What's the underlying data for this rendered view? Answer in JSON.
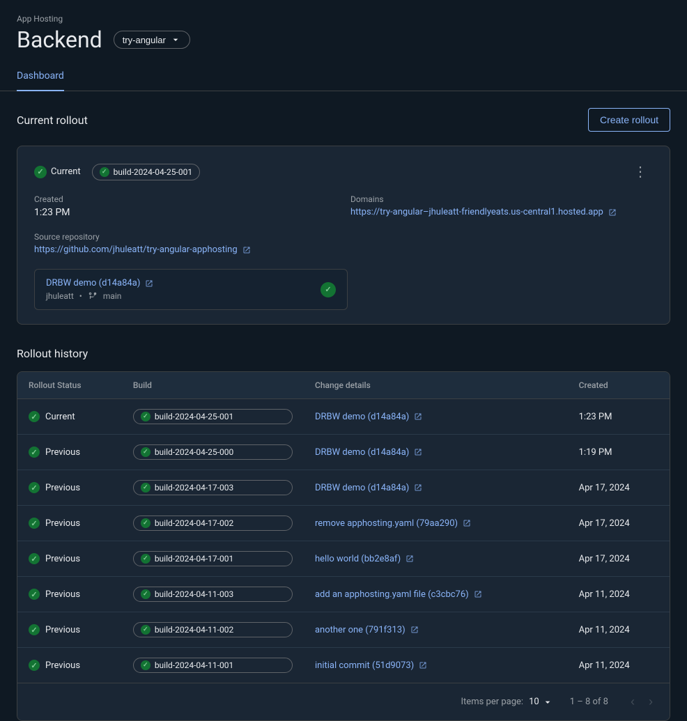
{
  "app": {
    "hosting_label": "App Hosting",
    "backend_title": "Backend",
    "branch": "try-angular"
  },
  "tabs": [
    {
      "label": "Dashboard",
      "active": true
    }
  ],
  "current_rollout": {
    "section_title": "Current rollout",
    "create_button": "Create rollout",
    "status": "Current",
    "build_id": "build-2024-04-25-001",
    "more_icon": "⋮",
    "created_label": "Created",
    "created_value": "1:23 PM",
    "source_repo_label": "Source repository",
    "source_repo_url": "https://github.com/jhuleatt/try-angular-apphosting",
    "source_repo_display": "https://github.com/jhuleatt/try-angular-apphosting",
    "domains_label": "Domains",
    "domain_url": "https://try-angular–jhuleatt-friendlyeats.us-central1.hosted.app",
    "domain_display": "https://try-angular–jhuleatt-friendlyeats.us-central1.hosted.app",
    "commit_link_text": "DRBW demo (d14a84a)",
    "commit_user": "jhuleatt",
    "commit_branch": "main"
  },
  "rollout_history": {
    "section_title": "Rollout history",
    "columns": [
      "Rollout Status",
      "Build",
      "Change details",
      "Created"
    ],
    "rows": [
      {
        "status": "Current",
        "build": "build-2024-04-25-001",
        "change": "DRBW demo (d14a84a)",
        "change_url": "#",
        "created": "1:23 PM"
      },
      {
        "status": "Previous",
        "build": "build-2024-04-25-000",
        "change": "DRBW demo (d14a84a)",
        "change_url": "#",
        "created": "1:19 PM"
      },
      {
        "status": "Previous",
        "build": "build-2024-04-17-003",
        "change": "DRBW demo (d14a84a)",
        "change_url": "#",
        "created": "Apr 17, 2024"
      },
      {
        "status": "Previous",
        "build": "build-2024-04-17-002",
        "change": "remove apphosting.yaml (79aa290)",
        "change_url": "#",
        "created": "Apr 17, 2024"
      },
      {
        "status": "Previous",
        "build": "build-2024-04-17-001",
        "change": "hello world (bb2e8af)",
        "change_url": "#",
        "created": "Apr 17, 2024"
      },
      {
        "status": "Previous",
        "build": "build-2024-04-11-003",
        "change": "add an apphosting.yaml file (c3cbc76)",
        "change_url": "#",
        "created": "Apr 11, 2024"
      },
      {
        "status": "Previous",
        "build": "build-2024-04-11-002",
        "change": "another one (791f313)",
        "change_url": "#",
        "created": "Apr 11, 2024"
      },
      {
        "status": "Previous",
        "build": "build-2024-04-11-001",
        "change": "initial commit (51d9073)",
        "change_url": "#",
        "created": "Apr 11, 2024"
      }
    ],
    "items_per_page_label": "Items per page:",
    "items_per_page_value": "10",
    "pagination_info": "1 – 8 of 8"
  }
}
